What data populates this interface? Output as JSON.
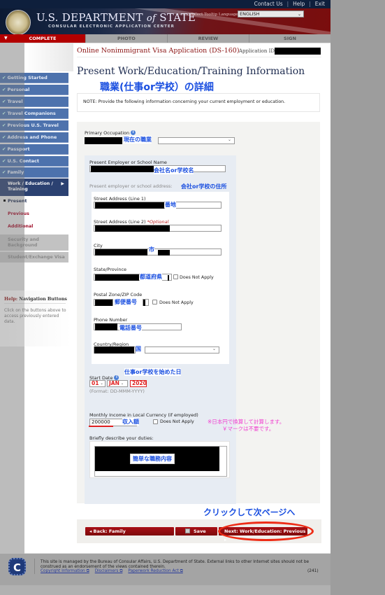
{
  "header": {
    "top_links": [
      "Contact Us",
      "Help",
      "Exit"
    ],
    "site_title_main": "U.S. DEPARTMENT",
    "site_title_of": "of",
    "site_title_state": "STATE",
    "site_subtitle": "CONSULAR ELECTRONIC APPLICATION CENTER",
    "tooltip_language_label": "Select Tooltip Language",
    "tooltip_language_value": "ENGLISH"
  },
  "progress_steps": [
    {
      "label": "COMPLETE",
      "active": true
    },
    {
      "label": "PHOTO",
      "active": false
    },
    {
      "label": "REVIEW",
      "active": false
    },
    {
      "label": "SIGN",
      "active": false
    }
  ],
  "app": {
    "title": "Online Nonimmigrant Visa Application (DS-160)",
    "id_label": "Application ID"
  },
  "page": {
    "title": "Present Work/Education/Training Information",
    "jp_title_annotation": "職業(仕事or学校）の詳細",
    "note": "NOTE: Provide the following information concerning your current employment or education."
  },
  "sidebar": {
    "completed_items": [
      "Getting Started",
      "Personal",
      "Travel",
      "Travel Companions",
      "Previous U.S. Travel",
      "Address and Phone",
      "Passport",
      "U.S. Contact",
      "Family"
    ],
    "current_section": "Work / Education / Training",
    "sub_items": [
      "Present",
      "Previous",
      "Additional"
    ],
    "disabled_items": [
      "Security and Background",
      "Student/Exchange Visa"
    ],
    "help_title_prefix": "Help:",
    "help_title": "Navigation Buttons",
    "help_text": "Click on the buttons above to access previously entered data."
  },
  "form": {
    "primary_occupation_label": "Primary Occupation",
    "primary_occupation_jp": "現在の職業",
    "employer_name_label": "Present Employer or School Name",
    "employer_name_jp": "会社名or学校名",
    "address_heading": "Present employer or school address:",
    "address_heading_jp": "会社or学校の住所",
    "street1_label": "Street Address (Line 1)",
    "street1_jp": "番地",
    "street2_label": "Street Address (Line 2)",
    "street2_optional": "*Optional",
    "city_label": "City",
    "city_jp": "市",
    "state_label": "State/Province",
    "state_jp": "都道府県",
    "state_dna": "Does Not Apply",
    "postal_label": "Postal Zone/ZIP Code",
    "postal_jp": "郵便番号",
    "postal_dna": "Does Not Apply",
    "phone_label": "Phone Number",
    "phone_jp": "電話番号",
    "country_label": "Country/Region",
    "country_jp": "国",
    "start_date_label": "Start Date",
    "start_date_jp": "仕事or学校を始めた日",
    "start_day": "01",
    "start_month": "JAN",
    "start_year": "2020",
    "date_format": "(Format: DD-MMM-YYYY)",
    "income_label": "Monthly Income in Local Currency (if employed)",
    "income_value": "200000",
    "income_jp": "収入額",
    "income_dna": "Does Not Apply",
    "income_note_line1": "※日本円で換算して計算します。",
    "income_note_line2": "￥マークは不要です。",
    "duties_label": "Briefly describe your duties:",
    "duties_jp": "簡単な職務内容"
  },
  "buttons": {
    "back": "◂ Back: Family",
    "save": "Save",
    "next": "Next: Work/Education: Previous ▸",
    "click_annotation": "クリックして次ページへ"
  },
  "footer": {
    "text": "This site is managed by the Bureau of Consular Affairs, U.S. Department of State. External links to other Internet sites should not be construed as an endorsement of the views contained therein.",
    "links": [
      "Copyright Information ⧉",
      "Disclaimers ⧉",
      "Paperwork Reduction Act ⧉"
    ],
    "page_code": "(241)"
  }
}
